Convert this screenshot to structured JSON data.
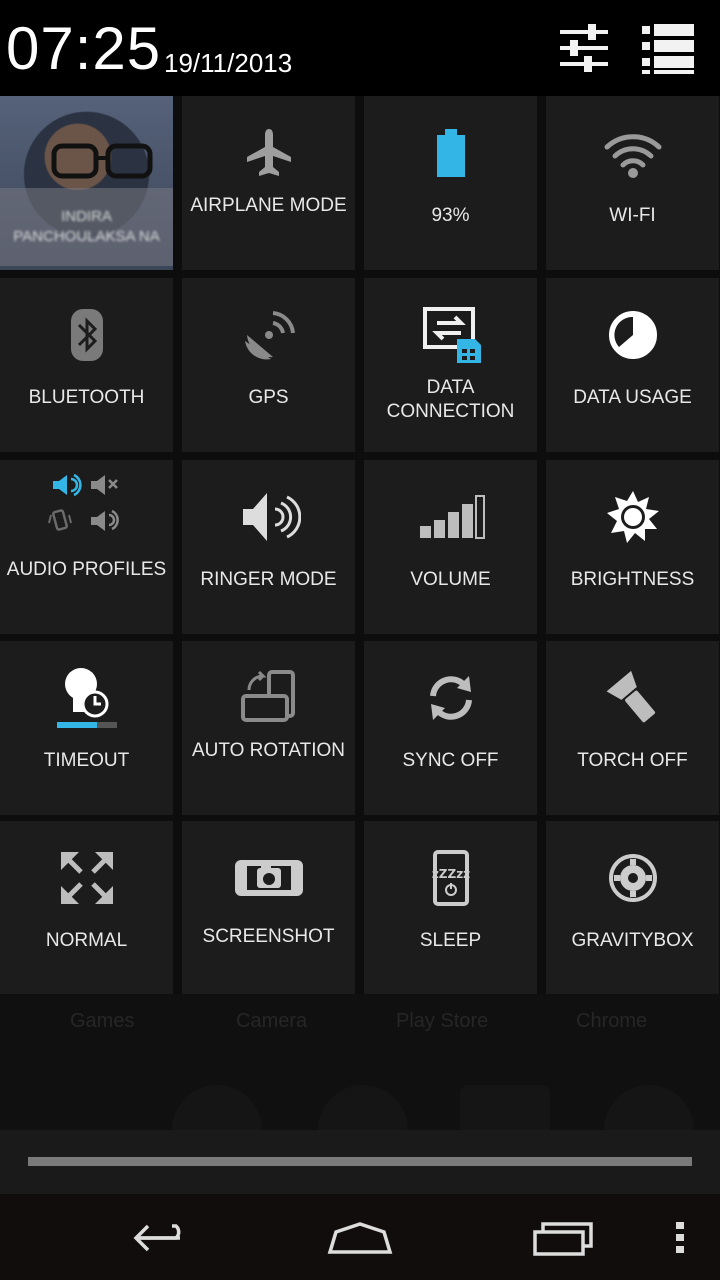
{
  "status": {
    "time": "07:25",
    "date": "19/11/2013"
  },
  "header": {
    "settings_icon": "tune-sliders-icon",
    "list_icon": "list-icon"
  },
  "profile": {
    "name": "INDIRA PANCHOULAKSA NA"
  },
  "tiles": [
    {
      "id": "airplane",
      "label": "AIRPLANE MODE",
      "icon": "airplane-icon"
    },
    {
      "id": "battery",
      "label": "93%",
      "icon": "battery-icon"
    },
    {
      "id": "wifi",
      "label": "WI-FI",
      "icon": "wifi-icon"
    },
    {
      "id": "bluetooth",
      "label": "BLUETOOTH",
      "icon": "bluetooth-icon"
    },
    {
      "id": "gps",
      "label": "GPS",
      "icon": "gps-icon"
    },
    {
      "id": "data",
      "label": "DATA CONNECTION",
      "icon": "data-connection-icon"
    },
    {
      "id": "usage",
      "label": "DATA USAGE",
      "icon": "data-usage-icon"
    },
    {
      "id": "audio",
      "label": "AUDIO PROFILES",
      "icon": "audio-profiles-icon"
    },
    {
      "id": "ringer",
      "label": "RINGER MODE",
      "icon": "ringer-icon"
    },
    {
      "id": "volume",
      "label": "VOLUME",
      "icon": "volume-icon"
    },
    {
      "id": "brightness",
      "label": "BRIGHTNESS",
      "icon": "brightness-icon"
    },
    {
      "id": "timeout",
      "label": "TIMEOUT",
      "icon": "timeout-icon"
    },
    {
      "id": "rotation",
      "label": "AUTO ROTATION",
      "icon": "rotation-icon"
    },
    {
      "id": "sync",
      "label": "SYNC OFF",
      "icon": "sync-icon"
    },
    {
      "id": "torch",
      "label": "TORCH OFF",
      "icon": "torch-icon"
    },
    {
      "id": "normal",
      "label": "NORMAL",
      "icon": "expand-icon"
    },
    {
      "id": "screenshot",
      "label": "SCREENSHOT",
      "icon": "camera-icon"
    },
    {
      "id": "sleep",
      "label": "SLEEP",
      "icon": "sleep-icon"
    },
    {
      "id": "gravitybox",
      "label": "GRAVITYBOX",
      "icon": "gear-icon"
    }
  ],
  "background_apps": [
    "Games",
    "Camera",
    "Play Store",
    "Chrome"
  ],
  "navbar": {
    "back": "back-icon",
    "home": "home-icon",
    "recents": "recents-icon",
    "menu": "menu-icon"
  },
  "colors": {
    "accent": "#33b5e5",
    "tile": "#1c1c1c",
    "icon": "#bdbdbd"
  }
}
